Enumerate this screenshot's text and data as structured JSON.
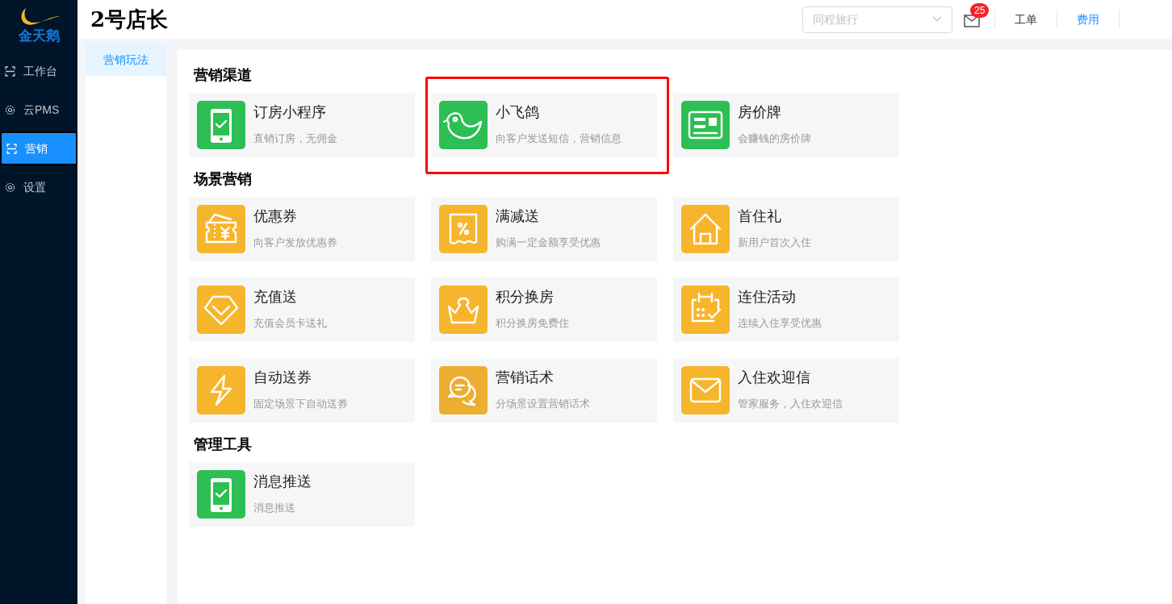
{
  "logo": {
    "text": "金天鹅"
  },
  "sidebar": {
    "items": [
      {
        "label": "工作台",
        "kind": "bracket",
        "selected": false
      },
      {
        "label": "云PMS",
        "kind": "gear",
        "selected": false
      },
      {
        "label": "营销",
        "kind": "bracket",
        "selected": true
      },
      {
        "label": "设置",
        "kind": "gear",
        "selected": false
      }
    ]
  },
  "header": {
    "title": "2号店长",
    "select": {
      "placeholder": "同程旅行"
    },
    "mail_badge": "25",
    "links": [
      {
        "label": "工单",
        "selected": false
      },
      {
        "label": "费用",
        "selected": true
      }
    ]
  },
  "subnav": {
    "items": [
      {
        "label": "营销玩法",
        "selected": true
      }
    ]
  },
  "sections": [
    {
      "title": "营销渠道",
      "cards": [
        {
          "title": "订房小程序",
          "desc": "直销订房，无佣金",
          "kind": "phone",
          "color": "#2dbf53",
          "highlighted": false
        },
        {
          "title": "小飞鸽",
          "desc": "向客户发送短信，营销信息",
          "kind": "bird",
          "color": "#2dbf53",
          "highlighted": true
        },
        {
          "title": "房价牌",
          "desc": "会赚钱的房价牌",
          "kind": "card",
          "color": "#2dbf53",
          "highlighted": false
        }
      ]
    },
    {
      "title": "场景营销",
      "cards": [
        {
          "title": "优惠券",
          "desc": "向客户发放优惠券",
          "kind": "coupon",
          "color": "#f7b52c",
          "highlighted": false
        },
        {
          "title": "满减送",
          "desc": "购满一定金额享受优惠",
          "kind": "percent",
          "color": "#f7b52c",
          "highlighted": false
        },
        {
          "title": "首住礼",
          "desc": "新用户首次入住",
          "kind": "house",
          "color": "#f7b52c",
          "highlighted": false
        },
        {
          "title": "充值送",
          "desc": "充值会员卡送礼",
          "kind": "diamond",
          "color": "#f7b52c",
          "highlighted": false
        },
        {
          "title": "积分换房",
          "desc": "积分换房免费住",
          "kind": "crown",
          "color": "#f7b52c",
          "highlighted": false
        },
        {
          "title": "连住活动",
          "desc": "连续入住享受优惠",
          "kind": "calendar",
          "color": "#f7b52c",
          "highlighted": false
        },
        {
          "title": "自动送券",
          "desc": "固定场景下自动送券",
          "kind": "bolt",
          "color": "#f7b52c",
          "highlighted": false
        },
        {
          "title": "营销话术",
          "desc": "分场景设置营销话术",
          "kind": "chat",
          "color": "#ecae32",
          "highlighted": false
        },
        {
          "title": "入住欢迎信",
          "desc": "管家服务，入住欢迎信",
          "kind": "mail",
          "color": "#f7b52c",
          "highlighted": false
        }
      ]
    },
    {
      "title": "管理工具",
      "cards": [
        {
          "title": "消息推送",
          "desc": "消息推送",
          "kind": "phone",
          "color": "#2dbf53",
          "highlighted": false
        }
      ]
    }
  ]
}
